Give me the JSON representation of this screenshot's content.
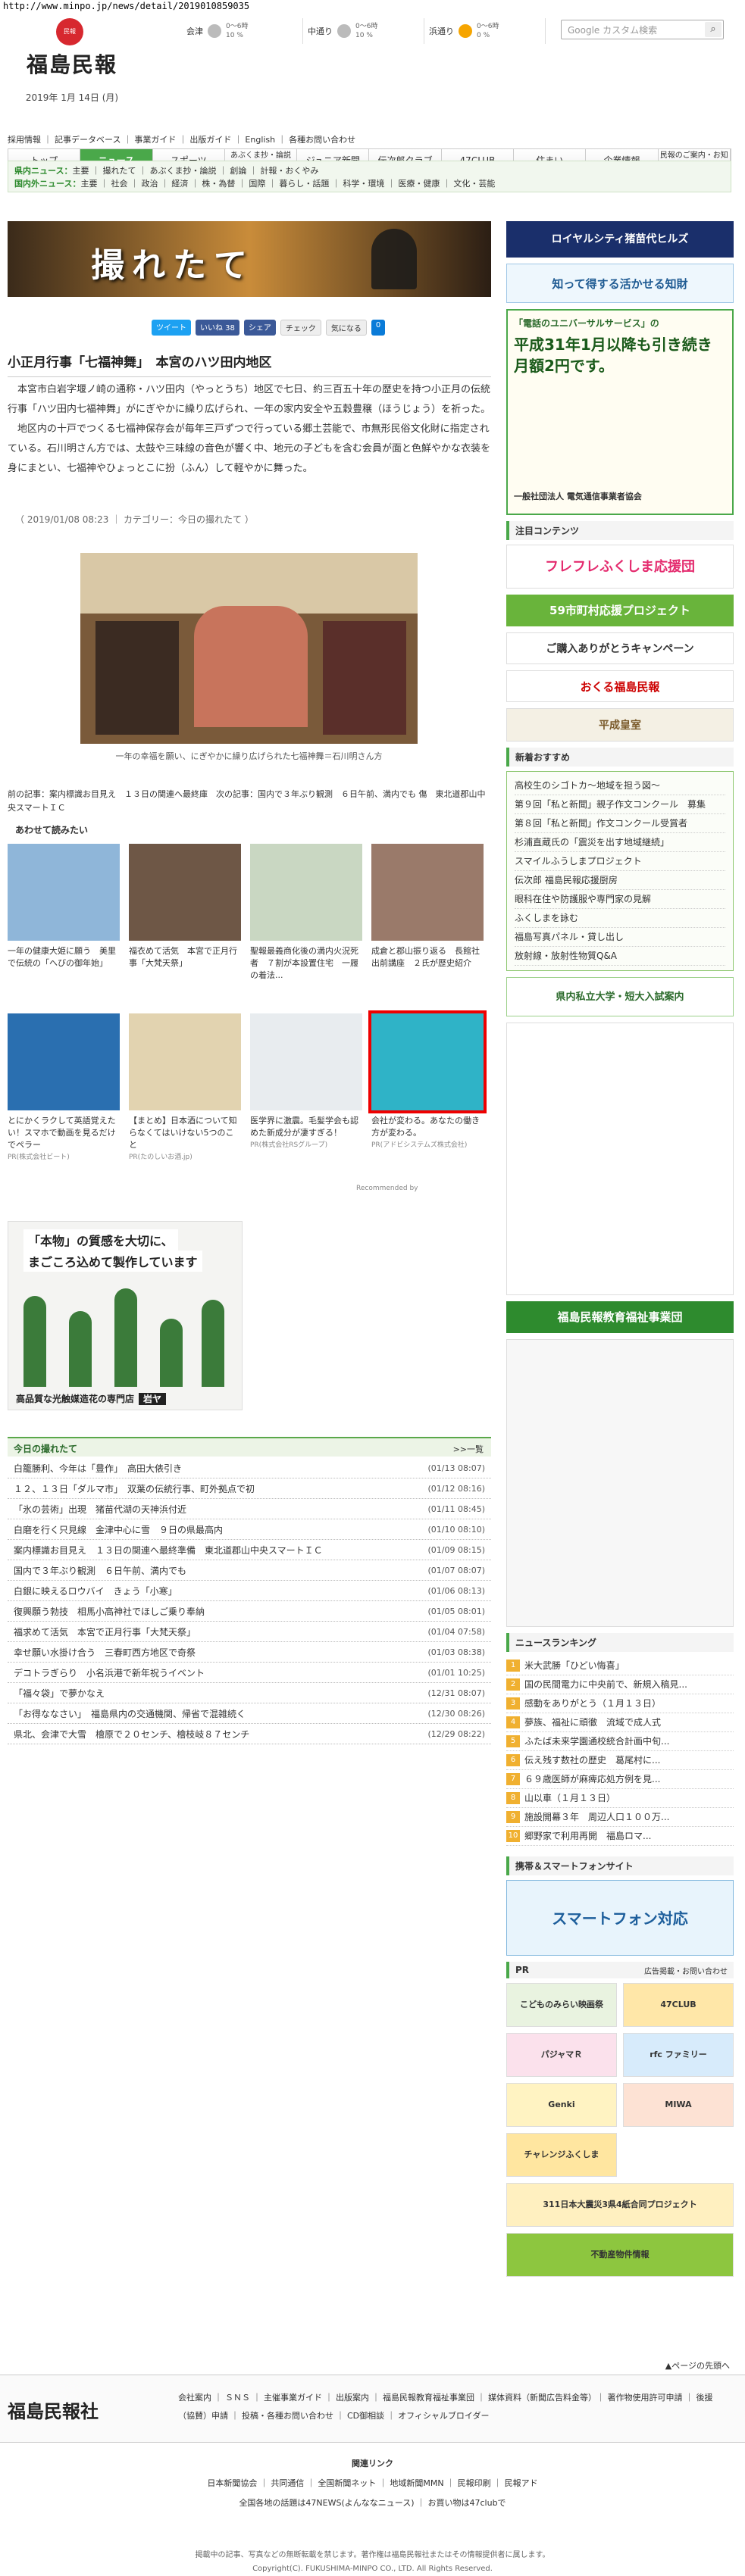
{
  "url": "http://www.minpo.jp/news/detail/2019010859035",
  "logo": {
    "seal": "民報",
    "name": "福島民報",
    "date": "2019年 1月 14日 (月)"
  },
  "weather": [
    {
      "city": "会津",
      "pct": "0〜6時",
      "val": "10 %"
    },
    {
      "city": "中通り",
      "pct": "0〜6時",
      "val": "10 %"
    },
    {
      "city": "浜通り",
      "pct": "0〜6時",
      "val": "0 %"
    }
  ],
  "search": {
    "placeholder": "Google カスタム検索"
  },
  "sublinks": "採用情報 ｜ 記事データベース ｜ 事業ガイド ｜ 出版ガイド ｜ English ｜ 各種お問い合わせ",
  "gnav": [
    "トップ",
    "ニュース",
    "スポーツ",
    "あぶくま抄・論説",
    "ジュニア新聞",
    "伝次郎クラブ",
    "47CLUB",
    "住まい",
    "企業情報",
    "民報のご案内・お知らせ"
  ],
  "subnav": {
    "l1_label": "県内ニュース：",
    "l1": "主要 ｜ 撮れたて ｜ あぶくま抄・論説 ｜ 創論 ｜ 計報・おくやみ",
    "l2_label": "国内外ニュース：",
    "l2": "主要 ｜ 社会 ｜ 政治 ｜ 経済 ｜ 株・為替 ｜ 国際 ｜ 暮らし・話題 ｜ 科学・環境 ｜ 医療・健康 ｜ 文化・芸能"
  },
  "banner": "撮れたて",
  "share": [
    "ツイート",
    "いいね 38",
    "シェア",
    "チェック",
    "気になる",
    "0"
  ],
  "article": {
    "title": "小正月行事「七福神舞」　本宮のハツ田内地区",
    "p1": "　本宮市白岩字堰ノ崎の通称・ハツ田内（やっとうち）地区で七日、約三百五十年の歴史を持つ小正月の伝統行事「ハツ田内七福神舞」がにぎやかに繰り広げられ、一年の家内安全や五穀豊穣（ほうじょう）を祈った。",
    "p2": "　地区内の十戸でつくる七福神保存会が毎年三戸ずつで行っている郷土芸能で、市無形民俗文化財に指定されている。石川明さん方では、太鼓や三味線の音色が響く中、地元の子どもを含む会員が面と色鮮やかな衣装を身にまとい、七福神やひょっとこに扮（ふん）して軽やかに舞った。",
    "meta": "（ 2019/01/08 08:23 ｜ カテゴリー：今日の撮れたて ）",
    "caption": "一年の幸福を願い、にぎやかに繰り広げられた七福神舞＝石川明さん方",
    "prevnext": "前の記事：案内標識お目見え　１３日の関連へ最終庫　次の記事：国内で３年ぶり観測　６日午前、満内でも 傷　東北道郡山中央スマートＩＣ"
  },
  "related": {
    "heading": "あわせて読みたい",
    "items": [
      {
        "text": "一年の健康大姫に願う　美里で伝統の「へびの御年始」",
        "pr": ""
      },
      {
        "text": "福衣めて活気　本宮で正月行事「大梵天祭」",
        "pr": ""
      },
      {
        "text": "聖報最義商化後の満内火況死者　７割が本設置住宅　一履の着法...",
        "pr": ""
      },
      {
        "text": "成倉と郡山振り返る　長館社出前講座　２氏が歴史紹介",
        "pr": ""
      },
      {
        "text": "とにかくラクして英語覚えたい！スマホで動画を見るだけでペラー",
        "pr": "PR(株式会社ビート)"
      },
      {
        "text": "【まとめ】日本酒について知らなくてはいけない5つのこと",
        "pr": "PR(たのしいお酒.jp)"
      },
      {
        "text": "医学界に激震。毛髪学会も認めた新成分が凄すぎる！",
        "pr": "PR(株式会社RSグループ)"
      },
      {
        "text": "会社が変わる。あなたの働き方が変わる。",
        "pr": "PR(アドビシステムズ株式会社)"
      }
    ],
    "recby": "Recommended by"
  },
  "ad": {
    "t1": "「本物」の質感を大切に、",
    "t2": "まごころ込めて製作しています",
    "bottom": "高品質な光触媒造花の専門店",
    "brand": "岩ヤ"
  },
  "today": {
    "heading": "今日の撮れたて",
    "more": ">>一覧",
    "rows": [
      {
        "t": "白籠勝利、今年は「豊作」　高田大俵引き",
        "d": "(01/13 08:07)"
      },
      {
        "t": "１２、１３日「ダルマ市」　双葉の伝統行事、町外拠点で初",
        "d": "(01/12 08:16)"
      },
      {
        "t": "「氷の芸術」出現　猪苗代湖の天神浜付近",
        "d": "(01/11 08:45)"
      },
      {
        "t": "白磨を行く只見線　金津中心に雪　９日の県最高内",
        "d": "(01/10 08:10)"
      },
      {
        "t": "案内標識お目見え　１３日の関連へ最終準備　東北道郡山中央スマートＩＣ",
        "d": "(01/09 08:15)"
      },
      {
        "t": "国内で３年ぶり観測　６日午前、満内でも",
        "d": "(01/07 08:07)"
      },
      {
        "t": "白銀に映えるロウバイ　きょう「小寒」",
        "d": "(01/06 08:13)"
      },
      {
        "t": "復興願う勃技　相馬小高神社でほしご乗り奉納",
        "d": "(01/05 08:01)"
      },
      {
        "t": "福求めて活気　本宮で正月行事「大梵天祭」",
        "d": "(01/04 07:58)"
      },
      {
        "t": "幸せ願い水掛け合う　三春町西方地区で奇祭",
        "d": "(01/03 08:38)"
      },
      {
        "t": "デコトラぎらり　小名浜港で新年祝うイベント",
        "d": "(01/01 10:25)"
      },
      {
        "t": "「福々袋」で夢かなえ",
        "d": "(12/31 08:07)"
      },
      {
        "t": "「お得ななさい」　福島県内の交通機関、帰省で混雑続く",
        "d": "(12/30 08:26)"
      },
      {
        "t": "県北、会津で大雪　檜原で２０センチ、檜枝岐８７センチ",
        "d": "(12/29 08:22)"
      }
    ]
  },
  "side": {
    "ad1": "ロイヤルシティ猪苗代ヒルズ",
    "ad1b": "知って得する活かせる知財",
    "ad2a": "「電話のユニバーサルサービス」の",
    "ad2b": "平成31年1月以降も引き続き月額2円です。",
    "ad2c": "一般社団法人 電気通信事業者協会",
    "pickup": "注目コンテンツ",
    "ban": [
      "フレフレふくしま応援団",
      "59市町村応援プロジェクト",
      "ご購入ありがとうキャンペーン",
      "おくる福島民報",
      "平成皇室",
      "福島民報教育福祉事業団"
    ],
    "news_h": "新着おすすめ",
    "news": [
      "高校生のシゴトカ〜地域を担う図〜",
      "第９回「私と新聞」親子作文コンクール　募集",
      "第８回「私と新聞」作文コンクール受賞者",
      "杉浦直蔵氏の「震災を出す地域継続」",
      "スマイルふうしまプロジェクト",
      "伝次郎 福島民報応援厨房",
      "眼科在住や防護服や専門家の見解",
      "ふくしまを詠む",
      "福島写真パネル・貸し出し",
      "放射線・放射性物質Q&A"
    ],
    "univ": "県内私立大学・短大入試案内",
    "ranking_h": "ニュースランキング",
    "ranking": [
      "米大武勝「ひどい悔喜」",
      "国の民間電力に中央前で、新規入稿見...",
      "感動をありがとう（１月１３日）",
      "夢族、福祉に頑徹　流域で成人式",
      "ふたば未来学園通校統合計画中旬...",
      "伝え残す数社の歴史　葛尾村に...",
      "６９歳医師が麻痺応処方例を見...",
      "山以車（１月１３日）",
      "施設開幕３年　周辺人口１００万...",
      "郷野家で利用再開　福島ロマ..."
    ],
    "mobile_h": "携帯＆スマートフォンサイト",
    "mobile": "スマートフォン対応",
    "pr_h": "PR",
    "pr_link": "広告掲載・お問い合わせ",
    "pr": [
      "こどものみらい映画祭",
      "47CLUB",
      "パジャマＲ",
      "rfc ファミリー",
      "Genki",
      "MIWA",
      "チャレンジふくしま",
      "311日本大震災3県4紙合同プロジェクト",
      "不動産物件情報"
    ]
  },
  "footer": {
    "top": "▲ページの先頭へ",
    "logo": "福島民報社",
    "links": "会社案内 ｜ ＳＮＳ ｜ 主催事業ガイド ｜ 出版案内 ｜ 福島民報教育福祉事業団 ｜ 媒体資料（新聞広告料金等）｜ 著作物使用許可申請 ｜ 後援（協賛）申請 ｜ 投稿・各種お問い合わせ ｜ CD御相談 ｜ オフィシャルブロイダー",
    "rel_h": "関連リンク",
    "rel1": "日本新聞協会 ｜ 共同通信 ｜ 全国新聞ネット ｜ 地域新聞MMN ｜ 民報印刷 ｜ 民報アド",
    "rel2": "全国各地の話題は47NEWS(よんななニュース) ｜ お買い物は47clubで",
    "cp1": "掲載中の記事、写真などの無断転載を禁じます。著作権は福島民報社またはその情報提供者に属します。",
    "cp2": "Copyright(C). FUKUSHIMA-MINPO CO., LTD. All Rights Reserved."
  },
  "colors": {
    "accent": "#4aa84a",
    "red": "#d7282f"
  }
}
